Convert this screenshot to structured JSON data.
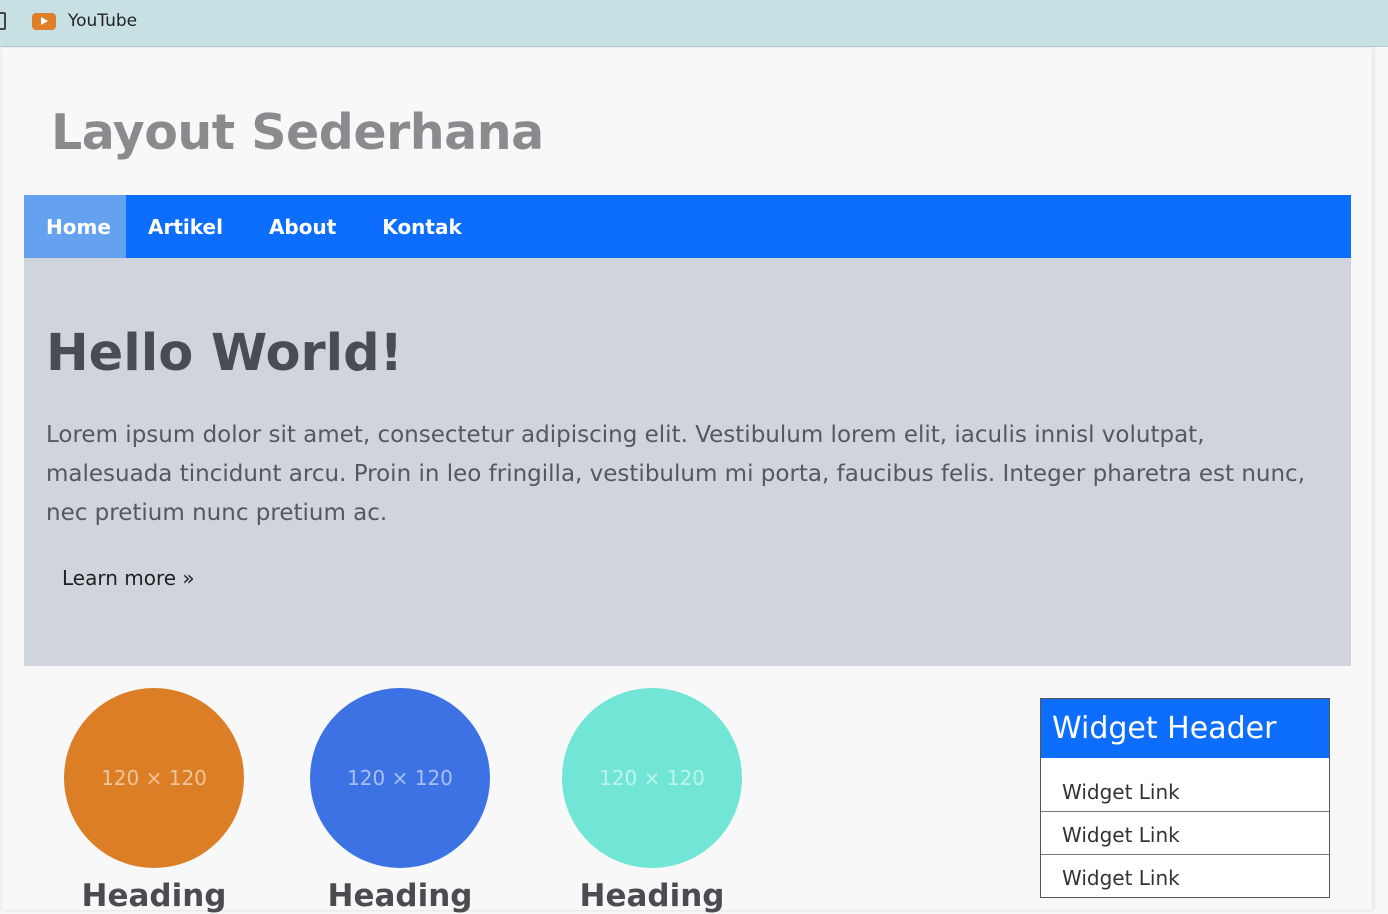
{
  "bookmarks": {
    "youtube_label": "YouTube"
  },
  "site": {
    "title": "Layout Sederhana"
  },
  "nav": {
    "items": [
      {
        "label": "Home",
        "active": true
      },
      {
        "label": "Artikel",
        "active": false
      },
      {
        "label": "About",
        "active": false
      },
      {
        "label": "Kontak",
        "active": false
      }
    ]
  },
  "jumbotron": {
    "title": "Hello World!",
    "text": "Lorem ipsum dolor sit amet, consectetur adipiscing elit. Vestibulum lorem elit, iaculis innisl volutpat, malesuada tincidunt arcu. Proin in leo fringilla, vestibulum mi porta, faucibus felis. Integer pharetra est nunc, nec pretium nunc pretium ac.",
    "learn_more": "Learn more »"
  },
  "features": [
    {
      "placeholder": "120 × 120",
      "heading": "Heading",
      "color": "#dc7e25"
    },
    {
      "placeholder": "120 × 120",
      "heading": "Heading",
      "color": "#3d72e4"
    },
    {
      "placeholder": "120 × 120",
      "heading": "Heading",
      "color": "#71e6d6"
    }
  ],
  "widget": {
    "header": "Widget Header",
    "links": [
      "Widget Link",
      "Widget Link",
      "Widget Link"
    ]
  },
  "colors": {
    "primary": "#0d6efd",
    "active_nav": "#64a2f0",
    "jumbotron_bg": "#d0d4dc",
    "bookmarks_bg": "#c6e0e4"
  }
}
